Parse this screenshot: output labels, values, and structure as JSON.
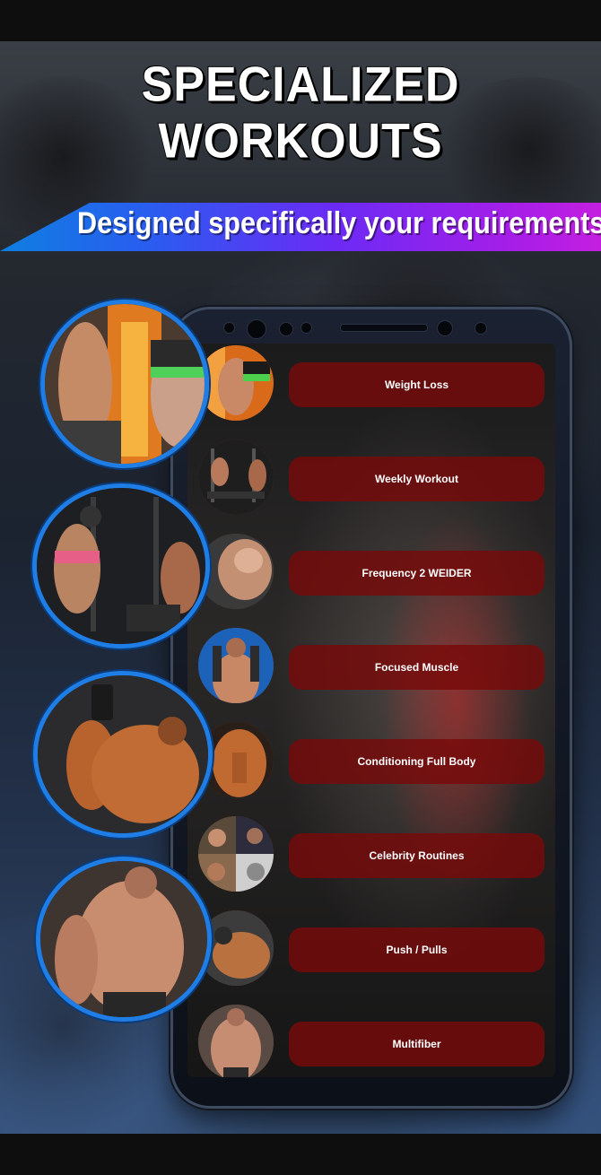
{
  "headline": "SPECIALIZED WORKOUTS",
  "subheadline": "Designed specifically your requirements",
  "colors": {
    "ribbon_start": "#0f7fe0",
    "ribbon_end": "#c41fe0",
    "pill": "#780a0a",
    "circle_border": "#1f7de6"
  },
  "workouts": [
    {
      "label": "Weight Loss",
      "icon": "fire-body-photo"
    },
    {
      "label": "Weekly Workout",
      "icon": "gym-photo"
    },
    {
      "label": "Frequency 2 WEIDER",
      "icon": "biceps-photo"
    },
    {
      "label": "Focused Muscle",
      "icon": "torso-photo"
    },
    {
      "label": "Conditioning Full Body",
      "icon": "abs-photo"
    },
    {
      "label": "Celebrity Routines",
      "icon": "celebrity-collage-photo"
    },
    {
      "label": "Push / Pulls",
      "icon": "back-photo"
    },
    {
      "label": "Multifiber",
      "icon": "physique-photo"
    }
  ]
}
